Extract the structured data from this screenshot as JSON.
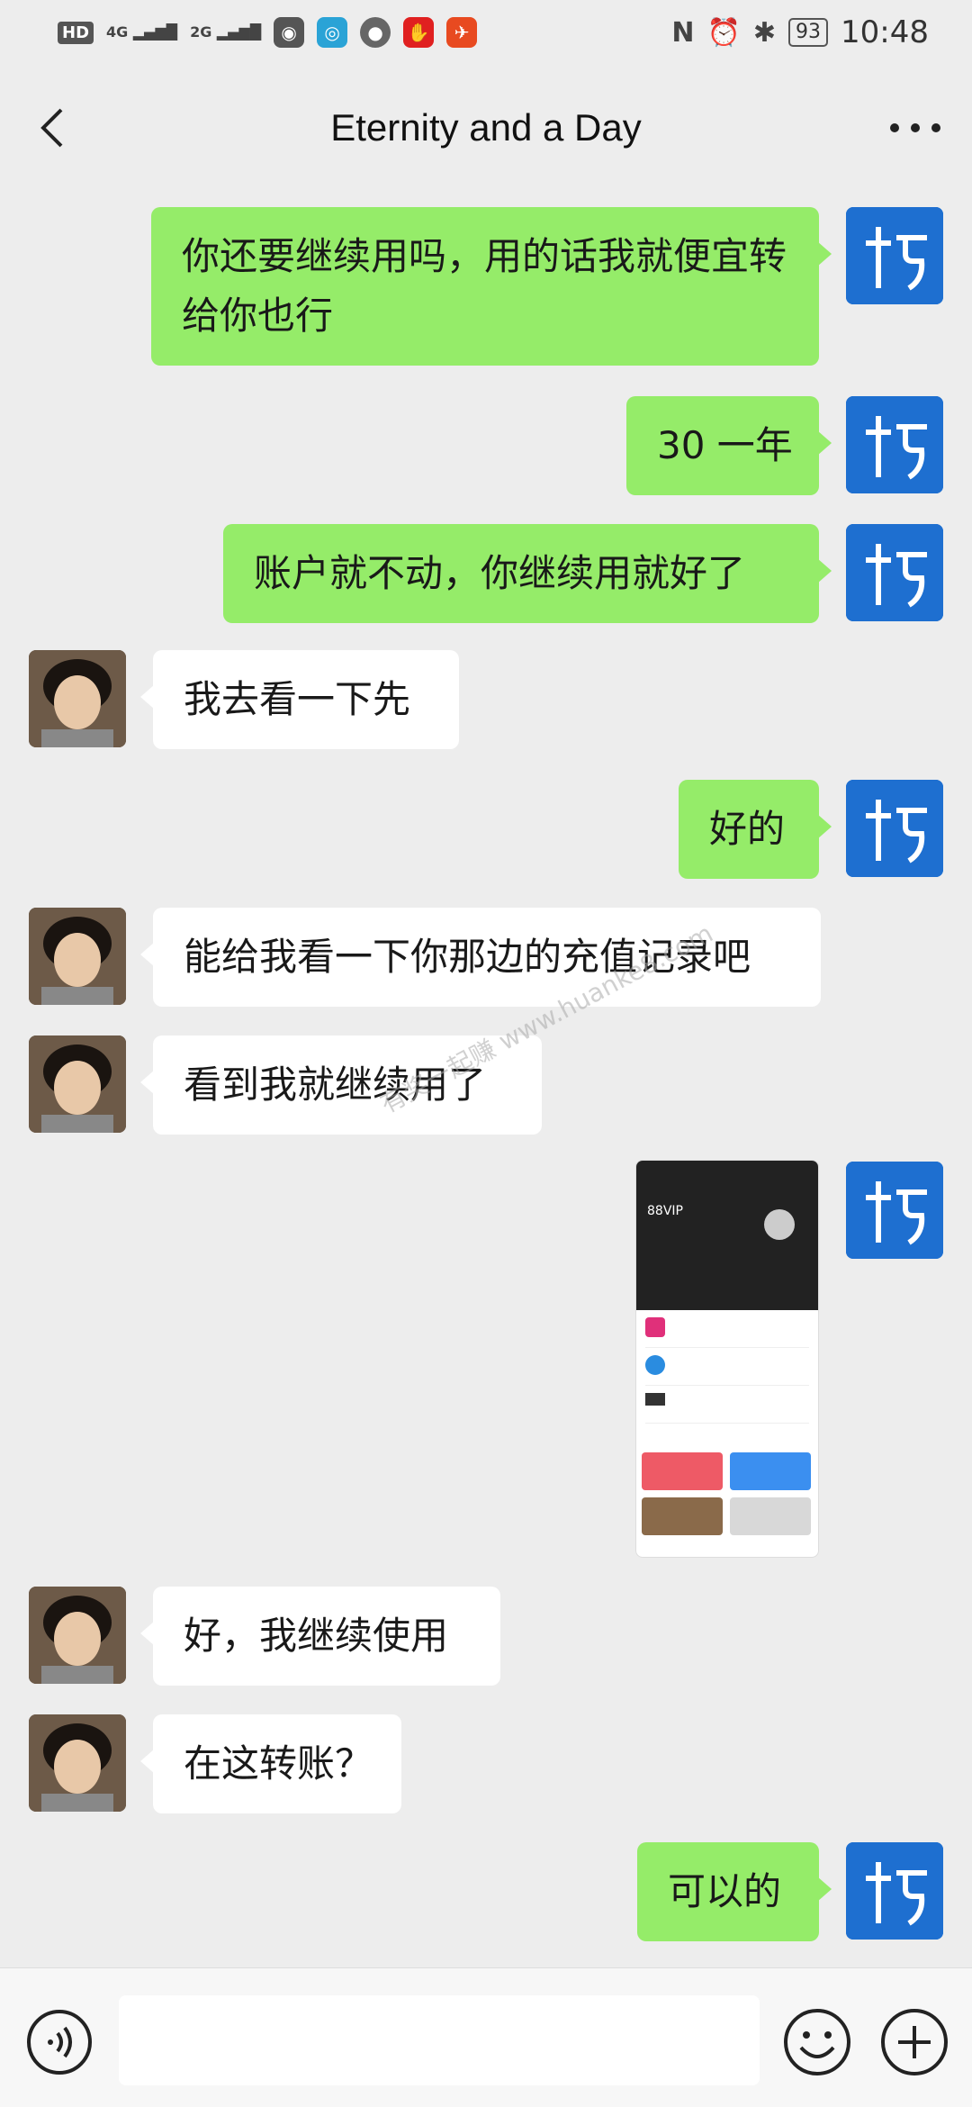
{
  "status_bar": {
    "hd_label": "HD",
    "net1": "4G",
    "net2": "2G",
    "battery": "93",
    "time": "10:48",
    "nfc_label": "N"
  },
  "nav": {
    "title": "Eternity and a Day"
  },
  "colors": {
    "my_bubble": "#95ec69",
    "friend_bubble": "#ffffff",
    "background": "#ededed",
    "my_avatar": "#1e6fd0"
  },
  "messages": [
    {
      "side": "me",
      "text": "你还要继续用吗，用的话我就便宜转给你也行"
    },
    {
      "side": "me",
      "text": "30 一年"
    },
    {
      "side": "me",
      "text": "账户就不动，你继续用就好了"
    },
    {
      "side": "friend",
      "text": "我去看一下先"
    },
    {
      "side": "me",
      "text": "好的"
    },
    {
      "side": "friend",
      "text": "能给我看一下你那边的充值记录吧"
    },
    {
      "side": "friend",
      "text": "看到我就继续用了"
    },
    {
      "side": "me",
      "type": "image",
      "text": "88VIP"
    },
    {
      "side": "friend",
      "text": "好，我继续使用"
    },
    {
      "side": "friend",
      "text": "在这转账？"
    },
    {
      "side": "me",
      "text": "可以的"
    }
  ],
  "watermark": "有奖一起赚 www.huanke8.com",
  "input": {
    "placeholder": ""
  }
}
